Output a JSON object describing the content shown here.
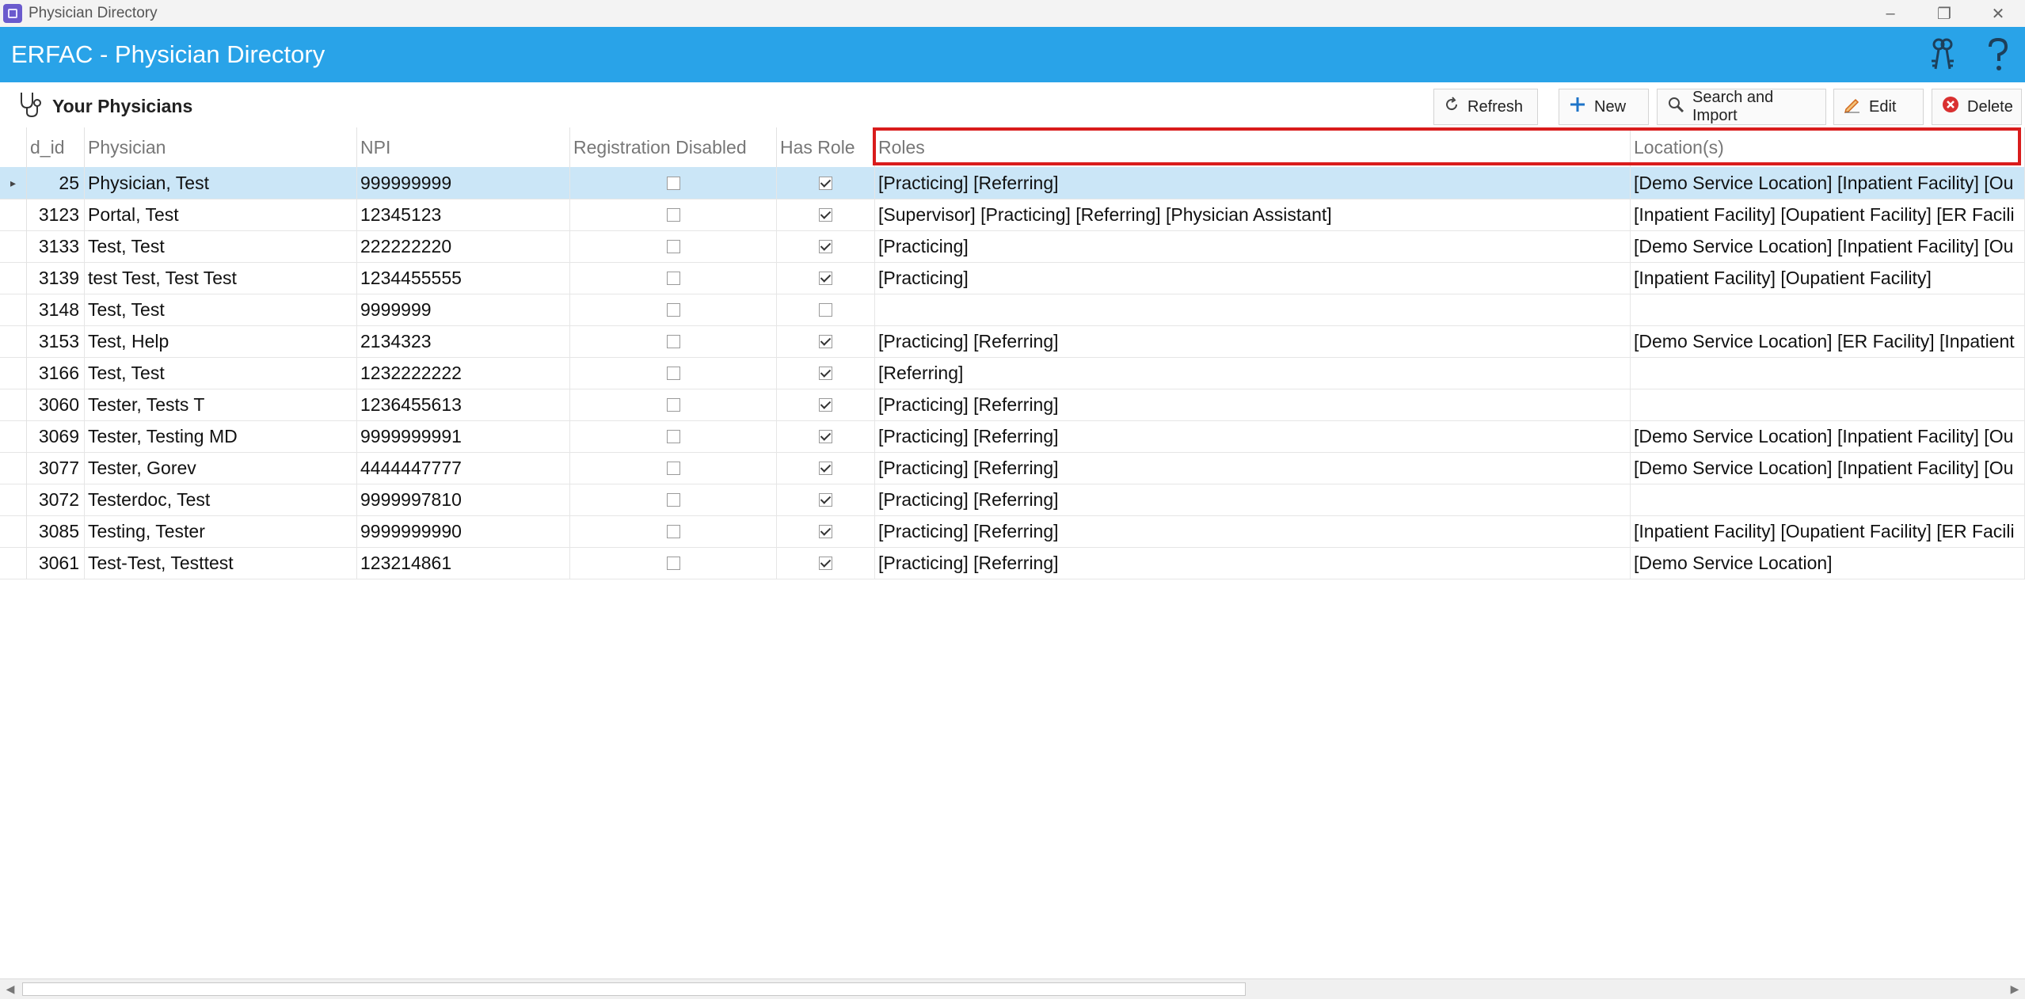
{
  "window": {
    "title": "Physician Directory",
    "controls": {
      "minimize": "–",
      "restore": "❐",
      "close": "✕"
    }
  },
  "appbar": {
    "title": "ERFAC - Physician Directory",
    "color": "#29a3e8",
    "icons": [
      "keys-icon",
      "help-icon"
    ]
  },
  "toolbar": {
    "section_title": "Your Physicians",
    "section_icon": "stethoscope-icon",
    "buttons": {
      "refresh": "Refresh",
      "new": "New",
      "search_import": "Search and Import",
      "edit": "Edit",
      "delete": "Delete"
    }
  },
  "grid": {
    "columns": {
      "id": "d_id",
      "physician": "Physician",
      "npi": "NPI",
      "registration_disabled": "Registration Disabled",
      "has_role": "Has Role",
      "roles": "Roles",
      "locations": "Location(s)"
    },
    "selected_row": 0,
    "highlight_color": "#d91c1c",
    "rows": [
      {
        "id": "25",
        "physician": "Physician, Test",
        "npi": "999999999",
        "reg_disabled": false,
        "has_role": true,
        "roles": "[Practicing] [Referring]",
        "locations": "[Demo Service Location] [Inpatient Facility] [Ou"
      },
      {
        "id": "3123",
        "physician": "Portal, Test",
        "npi": "12345123",
        "reg_disabled": false,
        "has_role": true,
        "roles": "[Supervisor] [Practicing] [Referring] [Physician Assistant]",
        "locations": "[Inpatient Facility] [Oupatient Facility] [ER Facili"
      },
      {
        "id": "3133",
        "physician": "Test, Test",
        "npi": "222222220",
        "reg_disabled": false,
        "has_role": true,
        "roles": "[Practicing]",
        "locations": "[Demo Service Location] [Inpatient Facility] [Ou"
      },
      {
        "id": "3139",
        "physician": "test Test, Test Test",
        "npi": "1234455555",
        "reg_disabled": false,
        "has_role": true,
        "roles": "[Practicing]",
        "locations": "[Inpatient Facility] [Oupatient Facility]"
      },
      {
        "id": "3148",
        "physician": "Test, Test",
        "npi": "9999999",
        "reg_disabled": false,
        "has_role": false,
        "roles": "",
        "locations": ""
      },
      {
        "id": "3153",
        "physician": "Test, Help",
        "npi": "2134323",
        "reg_disabled": false,
        "has_role": true,
        "roles": "[Practicing] [Referring]",
        "locations": "[Demo Service Location] [ER Facility] [Inpatient"
      },
      {
        "id": "3166",
        "physician": "Test, Test",
        "npi": "1232222222",
        "reg_disabled": false,
        "has_role": true,
        "roles": "[Referring]",
        "locations": ""
      },
      {
        "id": "3060",
        "physician": "Tester, Tests T",
        "npi": "1236455613",
        "reg_disabled": false,
        "has_role": true,
        "roles": "[Practicing] [Referring]",
        "locations": ""
      },
      {
        "id": "3069",
        "physician": "Tester, Testing MD",
        "npi": "9999999991",
        "reg_disabled": false,
        "has_role": true,
        "roles": "[Practicing] [Referring]",
        "locations": "[Demo Service Location] [Inpatient Facility] [Ou"
      },
      {
        "id": "3077",
        "physician": "Tester, Gorev",
        "npi": "4444447777",
        "reg_disabled": false,
        "has_role": true,
        "roles": "[Practicing] [Referring]",
        "locations": "[Demo Service Location] [Inpatient Facility] [Ou"
      },
      {
        "id": "3072",
        "physician": "Testerdoc, Test",
        "npi": "9999997810",
        "reg_disabled": false,
        "has_role": true,
        "roles": "[Practicing] [Referring]",
        "locations": ""
      },
      {
        "id": "3085",
        "physician": "Testing, Tester",
        "npi": "9999999990",
        "reg_disabled": false,
        "has_role": true,
        "roles": "[Practicing] [Referring]",
        "locations": "[Inpatient Facility] [Oupatient Facility] [ER Facili"
      },
      {
        "id": "3061",
        "physician": "Test-Test, Testtest",
        "npi": "123214861",
        "reg_disabled": false,
        "has_role": true,
        "roles": "[Practicing] [Referring]",
        "locations": "[Demo Service Location]"
      }
    ]
  }
}
